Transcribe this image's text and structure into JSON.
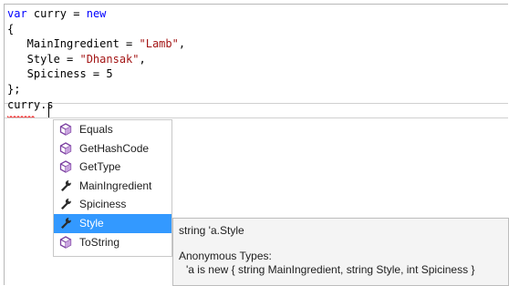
{
  "editor": {
    "lines": [
      [
        {
          "t": "var",
          "c": "kw"
        },
        {
          "t": " curry = ",
          "c": ""
        },
        {
          "t": "new",
          "c": "kw"
        }
      ],
      [
        {
          "t": "{",
          "c": ""
        }
      ],
      [
        {
          "t": "   MainIngredient = ",
          "c": ""
        },
        {
          "t": "\"Lamb\"",
          "c": "str"
        },
        {
          "t": ",",
          "c": ""
        }
      ],
      [
        {
          "t": "   Style = ",
          "c": ""
        },
        {
          "t": "\"Dhansak\"",
          "c": "str"
        },
        {
          "t": ",",
          "c": ""
        }
      ],
      [
        {
          "t": "   Spiciness = 5",
          "c": ""
        }
      ],
      [
        {
          "t": "};",
          "c": ""
        }
      ],
      [
        {
          "t": "curry.s",
          "c": ""
        }
      ]
    ]
  },
  "completion": {
    "items": [
      {
        "label": "Equals",
        "icon": "method-icon"
      },
      {
        "label": "GetHashCode",
        "icon": "method-icon"
      },
      {
        "label": "GetType",
        "icon": "method-icon"
      },
      {
        "label": "MainIngredient",
        "icon": "property-icon"
      },
      {
        "label": "Spiciness",
        "icon": "property-icon"
      },
      {
        "label": "Style",
        "icon": "property-icon",
        "selected": true
      },
      {
        "label": "ToString",
        "icon": "method-icon"
      }
    ]
  },
  "tooltip": {
    "signature": "string 'a.Style",
    "anon_heading": "Anonymous Types:",
    "anon_detail": "'a is new { string MainIngredient, string Style, int Spiciness }"
  },
  "colors": {
    "keyword": "#0000ff",
    "string": "#a31515",
    "selection": "#3399ff",
    "method_icon": "#7b3fa0"
  }
}
